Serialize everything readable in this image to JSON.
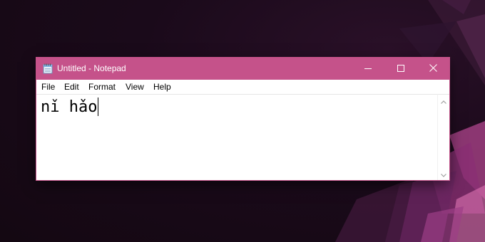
{
  "window": {
    "title": "Untitled - Notepad",
    "accent_color": "#c5528a",
    "app_icon": "notepad-icon"
  },
  "caption_buttons": {
    "minimize_icon": "minimize-icon",
    "maximize_icon": "maximize-icon",
    "close_icon": "close-icon"
  },
  "menu": {
    "items": [
      {
        "label": "File"
      },
      {
        "label": "Edit"
      },
      {
        "label": "Format"
      },
      {
        "label": "View"
      },
      {
        "label": "Help"
      }
    ]
  },
  "editor": {
    "content": "nǐ hǎo"
  },
  "scrollbar": {
    "up_icon": "chevron-up-icon",
    "down_icon": "chevron-down-icon"
  }
}
